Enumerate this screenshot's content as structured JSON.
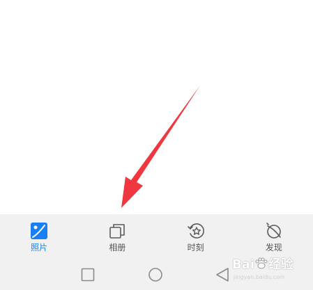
{
  "tabs": [
    {
      "label": "照片",
      "icon": "photo-icon",
      "active": true
    },
    {
      "label": "相册",
      "icon": "albums-icon",
      "active": false
    },
    {
      "label": "时刻",
      "icon": "moments-icon",
      "active": false
    },
    {
      "label": "发现",
      "icon": "discover-icon",
      "active": false
    }
  ],
  "nav": {
    "recents": "square-icon",
    "home": "circle-icon",
    "back": "triangle-back-icon"
  },
  "watermark": {
    "brand": "Bai",
    "paw": "paw-icon",
    "suffix": "经验",
    "url": "jingyan.baidu.com"
  },
  "colors": {
    "accent": "#1a7ff5",
    "inactive": "#555555",
    "bar_background": "#f1f1f1",
    "arrow": "#f0363f"
  }
}
